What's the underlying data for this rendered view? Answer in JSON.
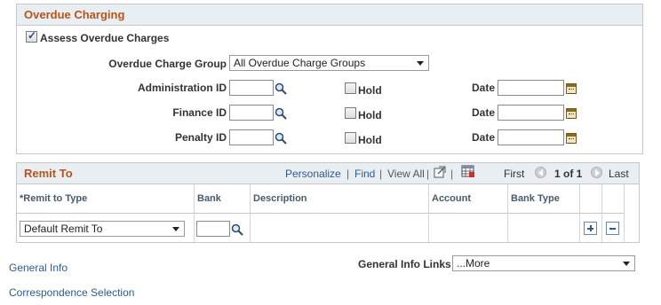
{
  "overdue_charging": {
    "title": "Overdue Charging",
    "assess_checkbox_label": "Assess Overdue Charges",
    "assess_checked": true,
    "charge_group_label": "Overdue Charge Group",
    "charge_group_value": "All Overdue Charge Groups",
    "rows": [
      {
        "id_label": "Administration ID",
        "hold_label": "Hold",
        "date_label": "Date"
      },
      {
        "id_label": "Finance ID",
        "hold_label": "Hold",
        "date_label": "Date"
      },
      {
        "id_label": "Penalty ID",
        "hold_label": "Hold",
        "date_label": "Date"
      }
    ]
  },
  "remit_to": {
    "title": "Remit To",
    "toolbar": {
      "personalize": "Personalize",
      "separator": "|",
      "find": "Find",
      "view_all": "View All",
      "first": "First",
      "range": "1 of 1",
      "last": "Last"
    },
    "columns": [
      "*Remit to Type",
      "Bank",
      "Description",
      "Account",
      "Bank Type"
    ],
    "row": {
      "remit_type": "Default Remit To"
    }
  },
  "footer": {
    "general_info": "General Info",
    "general_info_links_label": "General Info Links",
    "general_info_links_value": "...More",
    "correspondence": "Correspondence Selection"
  }
}
